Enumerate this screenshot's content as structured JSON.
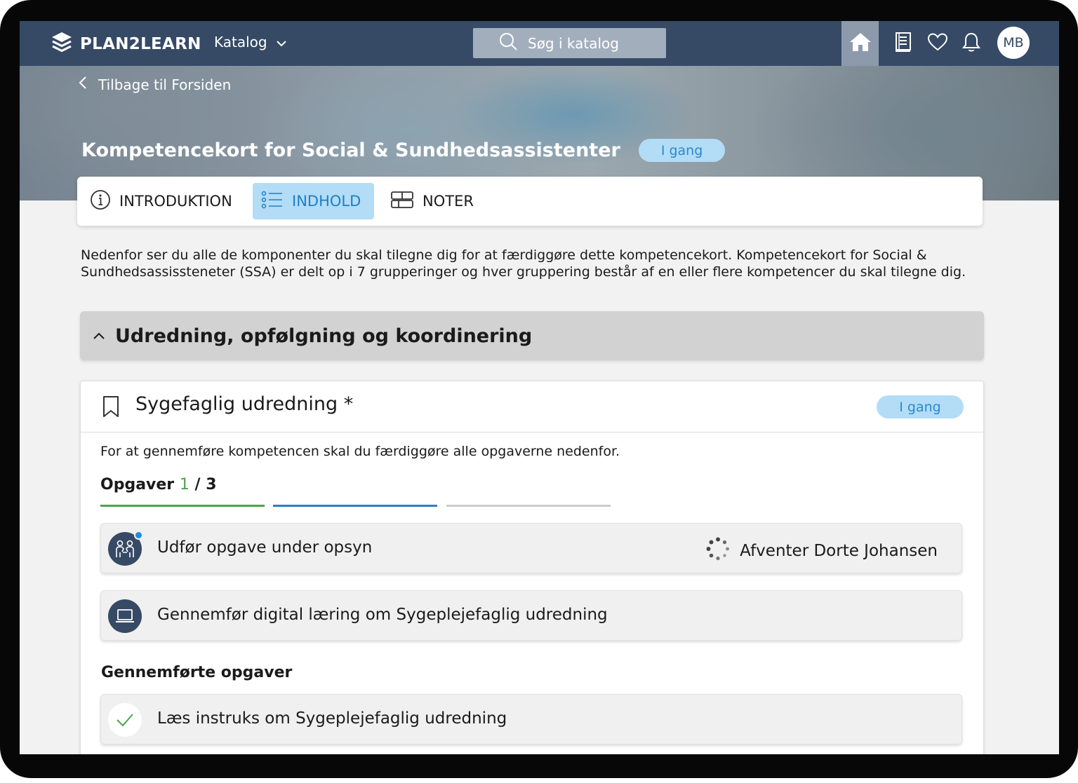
{
  "nav": {
    "brand": "PLAN2LEARN",
    "catalog_label": "Katalog",
    "search_placeholder": "Søg i katalog",
    "user_initials": "MB"
  },
  "hero": {
    "back_label": "Tilbage til Forsiden",
    "title": "Kompetencekort for Social & Sundhedsassistenter",
    "status": "I gang"
  },
  "tabs": [
    {
      "label": "INTRODUKTION",
      "active": false
    },
    {
      "label": "INDHOLD",
      "active": true
    },
    {
      "label": "NOTER",
      "active": false
    }
  ],
  "intro_text": "Nedenfor ser du alle de komponenter du skal tilegne dig for at færdiggøre dette kompetencekort. Kompetencekort for Social & Sundhedsassissteneter (SSA) er delt op i 7 grupperinger og hver gruppering består af en eller flere kompetencer du skal tilegne dig.",
  "group": {
    "title": "Udredning, opfølgning og koordinering",
    "expanded": true
  },
  "competence": {
    "title": "Sygefaglig udredning *",
    "status": "I gang",
    "description": "For at gennemføre kompetencen skal du færdiggøre alle opgaverne nedenfor.",
    "progress": {
      "label": "Opgaver",
      "completed": "1",
      "total": "/ 3",
      "segments": [
        "complete",
        "in-progress",
        "pending"
      ]
    },
    "tasks": [
      {
        "label": "Udfør opgave under opsyn",
        "icon": "supervision-icon",
        "status": "Afventer Dorte Johansen",
        "has_notification": true
      },
      {
        "label": "Gennemfør digital læring om Sygeplejefaglig udredning",
        "icon": "laptop-icon",
        "status": ""
      }
    ],
    "completed_section_title": "Gennemførte opgaver",
    "completed_tasks": [
      {
        "label": "Læs instruks om Sygeplejefaglig udredning",
        "icon": "check-icon"
      }
    ]
  },
  "colors": {
    "nav_bg": "#364a66",
    "badge_bg": "#b3dcf6",
    "badge_text": "#2a8ad0",
    "progress_complete": "#4aa54c",
    "progress_active": "#2a7fc8",
    "progress_pending": "#cccccc"
  }
}
